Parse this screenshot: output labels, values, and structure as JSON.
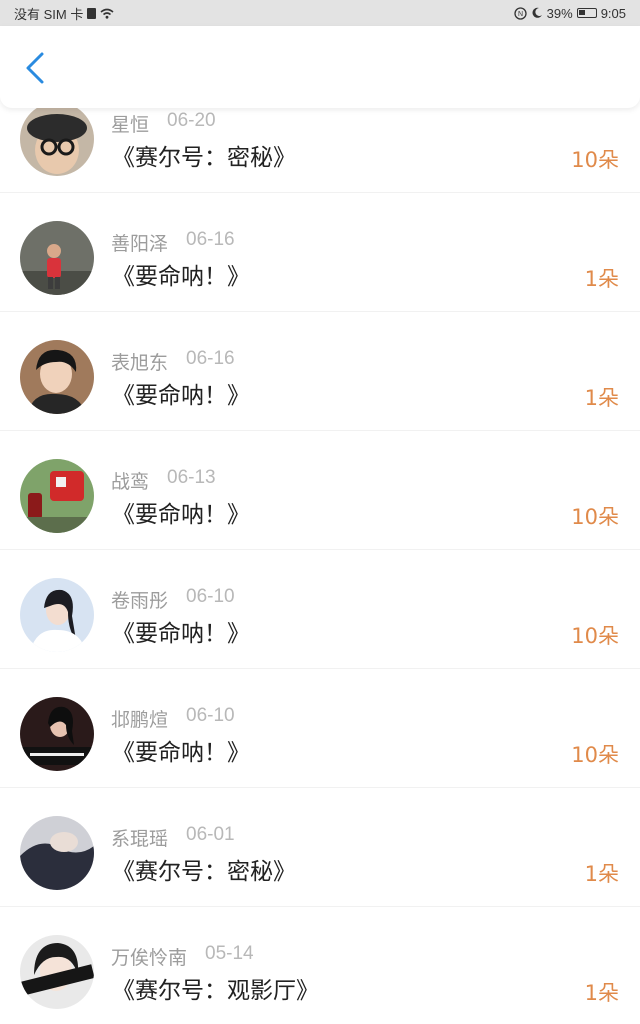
{
  "status_bar": {
    "carrier": "没有 SIM 卡",
    "battery": "39%",
    "time": "9:05"
  },
  "header": {
    "back_icon": "chevron-left-icon",
    "accent_color": "#2a8be0"
  },
  "items": [
    {
      "name": "星恒",
      "date": "06-20",
      "title": "《赛尔号：密秘》",
      "count": "10朵"
    },
    {
      "name": "善阳泽",
      "date": "06-16",
      "title": "《要命呐！》",
      "count": "1朵"
    },
    {
      "name": "表旭东",
      "date": "06-16",
      "title": "《要命呐！》",
      "count": "1朵"
    },
    {
      "name": "战鸾",
      "date": "06-13",
      "title": "《要命呐！》",
      "count": "10朵"
    },
    {
      "name": "卷雨彤",
      "date": "06-10",
      "title": "《要命呐！》",
      "count": "10朵"
    },
    {
      "name": "邶鹏煊",
      "date": "06-10",
      "title": "《要命呐！》",
      "count": "10朵"
    },
    {
      "name": "系琨瑶",
      "date": "06-01",
      "title": "《赛尔号：密秘》",
      "count": "1朵"
    },
    {
      "name": "万俟怜南",
      "date": "05-14",
      "title": "《赛尔号：观影厅》",
      "count": "1朵"
    }
  ],
  "colors": {
    "count": "#e08a4a",
    "name": "#9c9c9c",
    "title": "#222222"
  }
}
